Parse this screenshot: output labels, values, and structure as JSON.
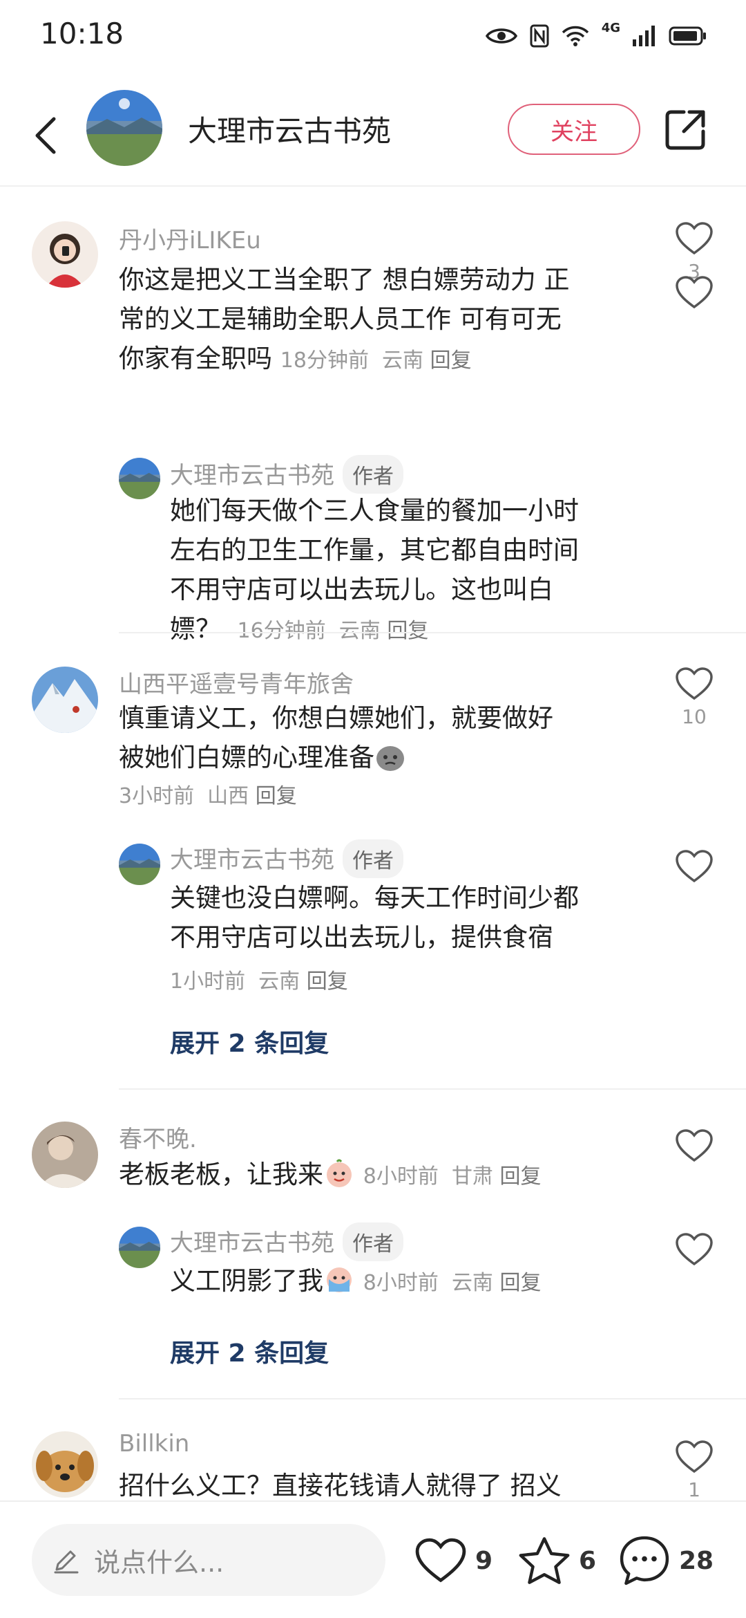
{
  "status": {
    "time": "10:18",
    "network": "4G"
  },
  "header": {
    "title": "大理市云古书苑",
    "follow_label": "关注"
  },
  "comments": [
    {
      "name": "丹小丹iLIKEu",
      "lines": [
        "你这是把义工当全职了 想白嫖劳动力 正",
        "常的义工是辅助全职人员工作 可有可无",
        "你家有全职吗"
      ],
      "time": "18分钟前",
      "location": "云南",
      "reply_label": "回复",
      "likes": "3",
      "replies": [
        {
          "name": "大理市云古书苑",
          "badge": "作者",
          "lines": [
            "她们每天做个三人食量的餐加一小时",
            "左右的卫生工作量，其它都自由时间",
            "不用守店可以出去玩儿。这也叫白",
            "嫖？"
          ],
          "time": "16分钟前",
          "location": "云南",
          "reply_label": "回复"
        }
      ]
    },
    {
      "name": "山西平遥壹号青年旅舍",
      "lines": [
        "慎重请义工，你想白嫖她们，就要做好",
        "被她们白嫖的心理准备"
      ],
      "time": "3小时前",
      "location": "山西",
      "reply_label": "回复",
      "likes": "10",
      "replies": [
        {
          "name": "大理市云古书苑",
          "badge": "作者",
          "lines": [
            "关键也没白嫖啊。每天工作时间少都",
            "不用守店可以出去玩儿，提供食宿"
          ],
          "time": "1小时前",
          "location": "云南",
          "reply_label": "回复"
        }
      ],
      "expand_label": "展开 2 条回复"
    },
    {
      "name": "春不晚.",
      "lines": [
        "老板老板，让我来"
      ],
      "time": "8小时前",
      "location": "甘肃",
      "reply_label": "回复",
      "replies": [
        {
          "name": "大理市云古书苑",
          "badge": "作者",
          "lines": [
            "义工阴影了我"
          ],
          "time": "8小时前",
          "location": "云南",
          "reply_label": "回复"
        }
      ],
      "expand_label": "展开 2 条回复"
    },
    {
      "name": "Billkin",
      "lines": [
        "招什么义工？直接花钱请人就得了 招义"
      ],
      "likes": "1"
    }
  ],
  "bottom": {
    "placeholder": "说点什么...",
    "likes": "9",
    "stars": "6",
    "comments": "28"
  },
  "colors": {
    "accent": "#e0415f",
    "link": "#1f3b66",
    "muted": "#999999"
  }
}
